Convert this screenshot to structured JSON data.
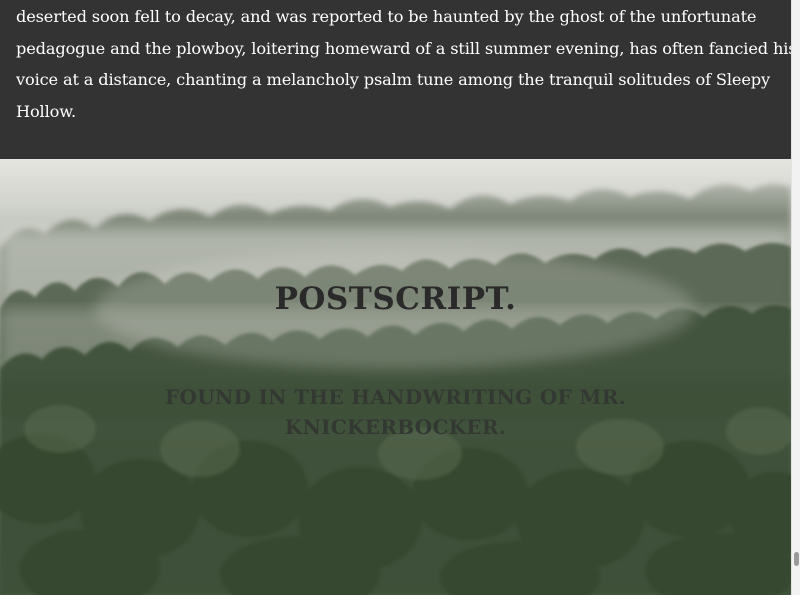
{
  "story": {
    "lines": [
      "deserted soon fell to decay, and was reported to be haunted by the ghost of the unfortunate",
      "pedagogue and the plowboy, loitering homeward of a still summer evening, has often fancied his",
      "voice at a distance, chanting a melancholy psalm tune among the tranquil solitudes of Sleepy",
      "Hollow."
    ]
  },
  "hero": {
    "title": "POSTSCRIPT.",
    "subtitle": "FOUND IN THE HANDWRITING OF MR. KNICKERBOCKER.",
    "background": "misty forest"
  },
  "colors": {
    "dark_section": "#333333",
    "text_light": "#ffffff",
    "heading": "#2a2a2a"
  }
}
